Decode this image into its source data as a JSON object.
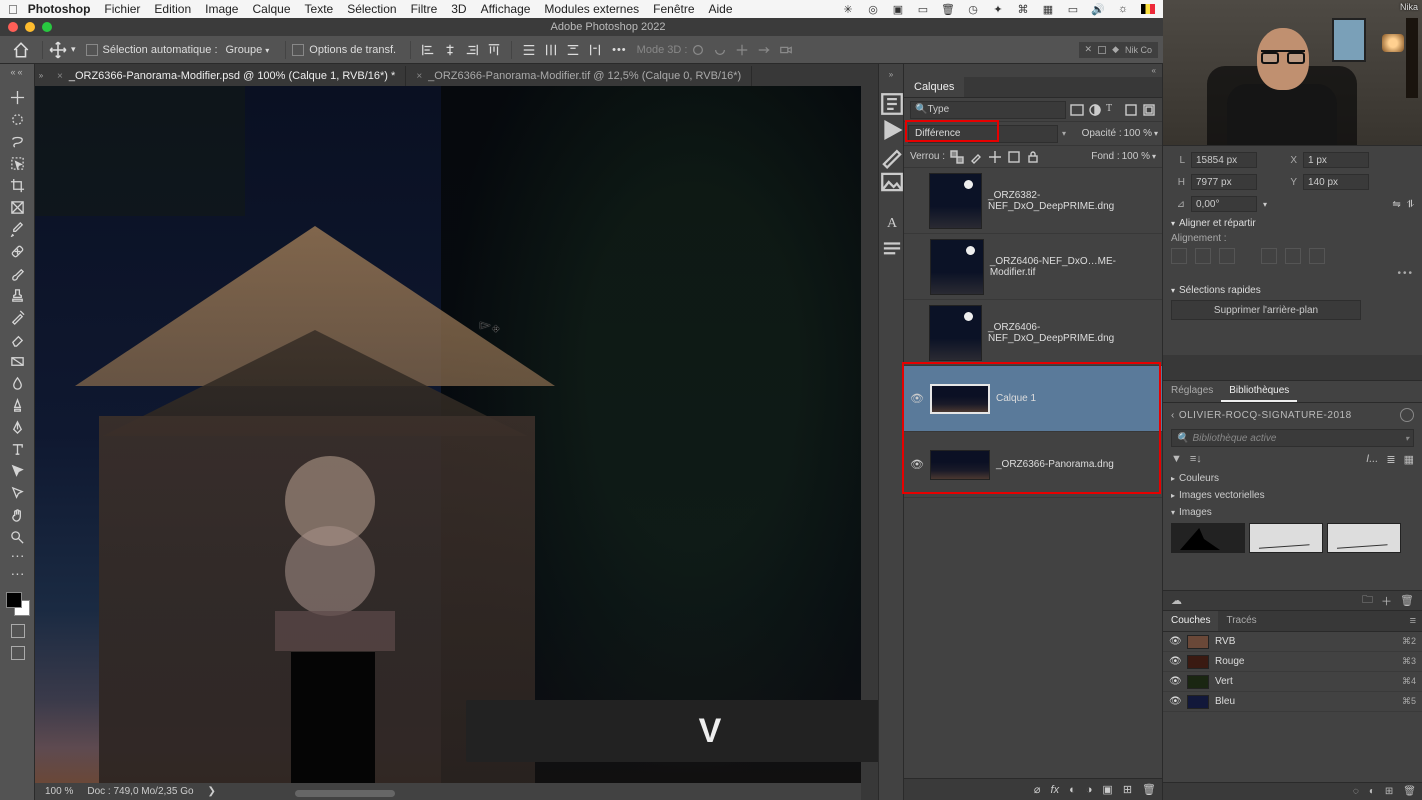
{
  "menubar": {
    "app": "Photoshop",
    "items": [
      "Fichier",
      "Edition",
      "Image",
      "Calque",
      "Texte",
      "Sélection",
      "Filtre",
      "3D",
      "Affichage",
      "Modules externes",
      "Fenêtre",
      "Aide"
    ]
  },
  "window_title": "Adobe Photoshop 2022",
  "options_bar": {
    "auto_select_label": "Sélection automatique :",
    "auto_select_value": "Groupe",
    "show_transform_label": "Options de transf.",
    "mode3d_label": "Mode 3D :",
    "ext_label": "Nik Co"
  },
  "tabs": [
    {
      "label": "_ORZ6366-Panorama-Modifier.psd @ 100% (Calque 1, RVB/16*) *",
      "active": true
    },
    {
      "label": "_ORZ6366-Panorama-Modifier.tif @ 12,5% (Calque 0, RVB/16*)",
      "active": false
    }
  ],
  "status_bar": {
    "zoom": "100 %",
    "doc": "Doc : 749,0 Mo/2,35 Go"
  },
  "key_overlay": "V",
  "layers_panel": {
    "title": "Calques",
    "type_filter": "Type",
    "blend_mode": "Différence",
    "opacity_label": "Opacité :",
    "opacity_value": "100 %",
    "lock_label": "Verrou :",
    "fill_label": "Fond :",
    "fill_value": "100 %",
    "layers": [
      {
        "name": "_ORZ6382-NEF_DxO_DeepPRIME.dng",
        "visible": false,
        "thumb": "night-moon",
        "selected": false
      },
      {
        "name": "_ORZ6406-NEF_DxO…ME-Modifier.tif",
        "visible": false,
        "thumb": "night-moon",
        "selected": false
      },
      {
        "name": "_ORZ6406-NEF_DxO_DeepPRIME.dng",
        "visible": false,
        "thumb": "night-moon",
        "selected": false
      },
      {
        "name": "Calque 1",
        "visible": true,
        "thumb": "strip",
        "selected": true
      },
      {
        "name": "_ORZ6366-Panorama.dng",
        "visible": true,
        "thumb": "strip",
        "selected": false
      }
    ]
  },
  "properties": {
    "L_label": "L",
    "L_value": "15854 px",
    "X_label": "X",
    "X_value": "1 px",
    "H_label": "H",
    "H_value": "7977 px",
    "Y_label": "Y",
    "Y_value": "140 px",
    "angle_label": "⊿",
    "angle_value": "0,00°",
    "align_header": "Aligner et répartir",
    "alignment_label": "Alignement :",
    "quick_header": "Sélections rapides",
    "quick_btn": "Supprimer l'arrière-plan"
  },
  "library": {
    "tabs": [
      "Réglages",
      "Bibliothèques"
    ],
    "name": "OLIVIER-ROCQ-SIGNATURE-2018",
    "search_placeholder": "Bibliothèque active",
    "sections": [
      "Couleurs",
      "Images vectorielles",
      "Images"
    ]
  },
  "channels": {
    "tabs": [
      "Couches",
      "Tracés"
    ],
    "rows": [
      {
        "name": "RVB",
        "shortcut": "⌘2",
        "color": "#6a4838"
      },
      {
        "name": "Rouge",
        "shortcut": "⌘3",
        "color": "#3a1a12"
      },
      {
        "name": "Vert",
        "shortcut": "⌘4",
        "color": "#1a2612"
      },
      {
        "name": "Bleu",
        "shortcut": "⌘5",
        "color": "#12183a"
      }
    ]
  },
  "webcam_brand": "Nika"
}
